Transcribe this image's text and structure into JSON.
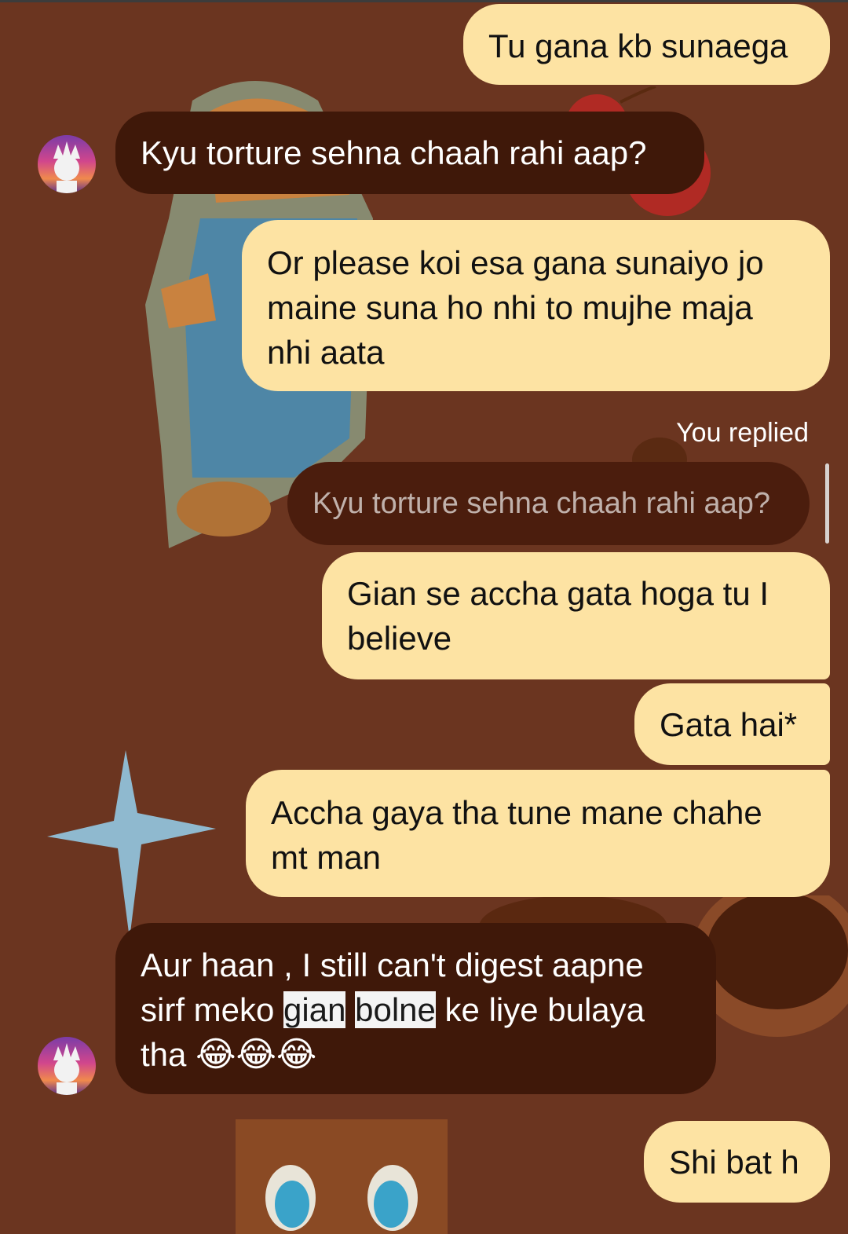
{
  "chat": {
    "messages": [
      {
        "type": "sent",
        "text": "Tu gana kb sunaega"
      },
      {
        "type": "received",
        "text": "Kyu torture sehna chaah rahi aap?"
      },
      {
        "type": "sent",
        "text": "Or please koi esa gana sunaiyo jo maine suna ho nhi to mujhe maja nhi aata"
      },
      {
        "type": "reply_label",
        "text": "You replied"
      },
      {
        "type": "quoted",
        "text": "Kyu torture sehna chaah rahi aap?"
      },
      {
        "type": "sent",
        "text": "Gian se accha gata hoga tu I believe"
      },
      {
        "type": "sent",
        "text": "Gata hai*"
      },
      {
        "type": "sent",
        "text": "Accha gaya tha tune mane chahe mt man"
      },
      {
        "type": "received",
        "parts": [
          "Aur haan , I still can't digest aapne sirf meko ",
          "gian",
          " ",
          "bolne",
          " ke liye bulaya tha ",
          "😂😂😂"
        ]
      },
      {
        "type": "sent",
        "text": "Shi bat h"
      }
    ]
  },
  "colors": {
    "background": "#6b3520",
    "sent_bubble": "#fde3a3",
    "received_bubble": "#3f1809",
    "highlight": "#f4f4f4"
  },
  "icons": {
    "avatar": "rick-sanchez-avatar-icon",
    "decorations": [
      "teddy-bear-sticker",
      "cherry-sticker",
      "star-sticker",
      "donut-sticker",
      "cookie-face-sticker"
    ]
  }
}
